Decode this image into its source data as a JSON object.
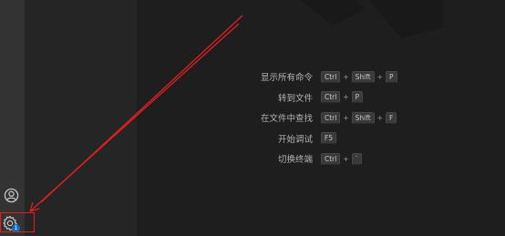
{
  "activity_bar": {
    "account_icon": "account-icon",
    "settings_icon": "gear-icon",
    "settings_badge": "1"
  },
  "shortcuts": [
    {
      "label": "显示所有命令",
      "keys": [
        "Ctrl",
        "Shift",
        "P"
      ]
    },
    {
      "label": "转到文件",
      "keys": [
        "Ctrl",
        "P"
      ]
    },
    {
      "label": "在文件中查找",
      "keys": [
        "Ctrl",
        "Shift",
        "F"
      ]
    },
    {
      "label": "开始调试",
      "keys": [
        "F5"
      ]
    },
    {
      "label": "切换终端",
      "keys": [
        "Ctrl",
        "`"
      ]
    }
  ],
  "plus_sign": "+",
  "colors": {
    "annotation_red": "#e02020",
    "badge_blue": "#0e70c0"
  }
}
